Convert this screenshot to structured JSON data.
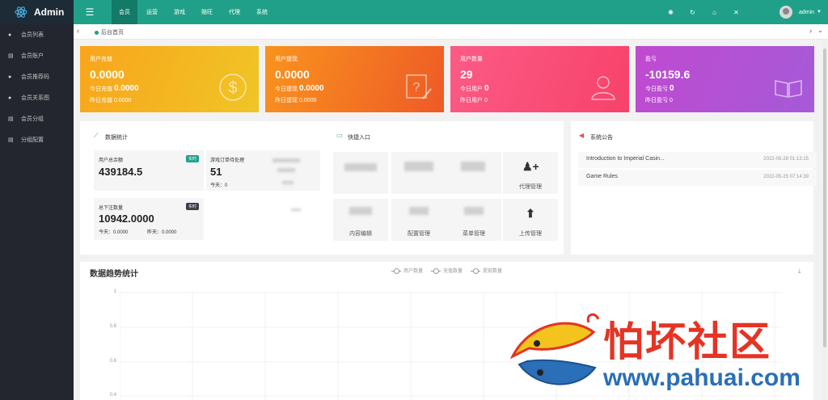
{
  "app": {
    "name": "Admin"
  },
  "header": {
    "nav": [
      "会员",
      "运营",
      "游戏",
      "赔旺",
      "代理",
      "系统"
    ],
    "tools": [
      "settings-icon",
      "refresh-icon",
      "lock-icon",
      "fullscreen-icon"
    ],
    "user": "admin"
  },
  "sidebar": {
    "items": [
      {
        "label": "会员列表",
        "icon": "user-icon"
      },
      {
        "label": "会员账户",
        "icon": "list-icon"
      },
      {
        "label": "会员推荐码",
        "icon": "user-plus-icon"
      },
      {
        "label": "会员关系图",
        "icon": "users-icon"
      },
      {
        "label": "会员分组",
        "icon": "list-icon"
      },
      {
        "label": "分组配置",
        "icon": "list-icon"
      }
    ]
  },
  "tabs": {
    "home": "后台首页"
  },
  "cards": [
    {
      "title": "用户充值",
      "value": "0.0000",
      "today_label": "今日充值",
      "today": "0.0000",
      "yesterday_label": "昨日充值",
      "yesterday": "0.0000",
      "icon": "dollar-icon",
      "color": "#f5a623"
    },
    {
      "title": "用户提现",
      "value": "0.0000",
      "today_label": "今日提现",
      "today": "0.0000",
      "yesterday_label": "昨日提现",
      "yesterday": "0.0000",
      "icon": "edit-icon",
      "color": "#f3791f"
    },
    {
      "title": "用户数量",
      "value": "29",
      "today_label": "今日用户",
      "today": "0",
      "yesterday_label": "昨日用户",
      "yesterday": "0",
      "icon": "user-icon",
      "color": "#f7476d"
    },
    {
      "title": "盈亏",
      "value": "-10159.6",
      "today_label": "今日盈亏",
      "today": "0",
      "yesterday_label": "昨日盈亏",
      "yesterday": "0",
      "icon": "book-icon",
      "color": "#b449d0"
    }
  ],
  "stats": {
    "title": "数据统计",
    "balance": {
      "label": "用户总余额",
      "value": "439184.5",
      "badge": "实时"
    },
    "orders": {
      "label": "游戏订单待处理",
      "value": "51",
      "today": "今天：0"
    },
    "bets": {
      "label": "总下注数量",
      "value": "10942.0000",
      "badge": "实时",
      "today": "今天：0.0000",
      "yesterday": "昨天：0.0000"
    }
  },
  "quick": {
    "title": "快捷入口",
    "items": [
      {
        "label": "代理管理",
        "icon": "user-plus-icon"
      },
      {
        "label": "内容编辑",
        "icon": ""
      },
      {
        "label": "配置管理",
        "icon": ""
      },
      {
        "label": "菜单管理",
        "icon": ""
      },
      {
        "label": "上传管理",
        "icon": "upload-icon"
      }
    ]
  },
  "notice": {
    "title": "系统公告",
    "items": [
      {
        "title": "Introduction to Imperial Casin...",
        "date": "2022-05-28 01:13:15"
      },
      {
        "title": "Game Rules",
        "date": "2022-05-25 07:14:39"
      }
    ]
  },
  "trend": {
    "title": "数据趋势统计",
    "legend": [
      "用户数量",
      "充值数量",
      "提现数量"
    ],
    "yticks": [
      "1",
      "0.8",
      "0.6",
      "0.4"
    ]
  },
  "watermark": {
    "title": "怕坏社区",
    "url": "www.pahuai.com"
  }
}
